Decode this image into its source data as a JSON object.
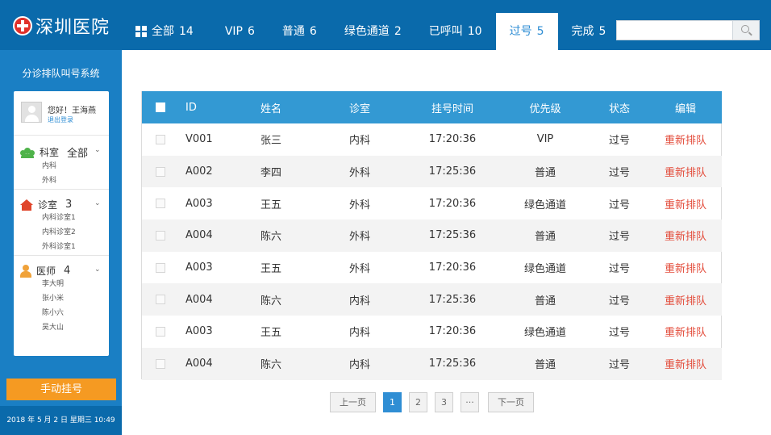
{
  "header": {
    "hospital_name": "深圳医院",
    "tabs": [
      {
        "label": "全部",
        "count": "14"
      },
      {
        "label": "VIP",
        "count": "6"
      },
      {
        "label": "普通",
        "count": "6"
      },
      {
        "label": "绿色通道",
        "count": "2"
      },
      {
        "label": "已呼叫",
        "count": "10"
      },
      {
        "label": "过号",
        "count": "5"
      },
      {
        "label": "完成",
        "count": "5"
      }
    ],
    "active_tab": "过号",
    "search_placeholder": "",
    "search_value": ""
  },
  "sidebar": {
    "system_title": "分诊排队叫号系统",
    "greeting": "您好！王海燕",
    "logout": "退出登录",
    "departments": {
      "label": "科室",
      "value": "全部",
      "items": [
        "内科",
        "外科"
      ]
    },
    "clinics": {
      "label": "诊室",
      "value": "3",
      "items": [
        "内科诊室1",
        "内科诊室2",
        "外科诊室1"
      ]
    },
    "doctors": {
      "label": "医师",
      "value": "4",
      "items": [
        "李大明",
        "张小米",
        "陈小六",
        "吴大山"
      ]
    },
    "manual_register": "手动挂号",
    "datetime": "2018 年 5 月 2 日 星期三  10:49"
  },
  "table": {
    "columns": [
      "ID",
      "姓名",
      "诊室",
      "挂号时间",
      "优先级",
      "状态",
      "编辑"
    ],
    "rows": [
      {
        "id": "V001",
        "name": "张三",
        "room": "内科",
        "time": "17:20:36",
        "priority": "VIP",
        "status": "过号",
        "action": "重新排队"
      },
      {
        "id": "A002",
        "name": "李四",
        "room": "外科",
        "time": "17:25:36",
        "priority": "普通",
        "status": "过号",
        "action": "重新排队"
      },
      {
        "id": "A003",
        "name": "王五",
        "room": "外科",
        "time": "17:20:36",
        "priority": "绿色通道",
        "status": "过号",
        "action": "重新排队"
      },
      {
        "id": "A004",
        "name": "陈六",
        "room": "外科",
        "time": "17:25:36",
        "priority": "普通",
        "status": "过号",
        "action": "重新排队"
      },
      {
        "id": "A003",
        "name": "王五",
        "room": "外科",
        "time": "17:20:36",
        "priority": "绿色通道",
        "status": "过号",
        "action": "重新排队"
      },
      {
        "id": "A004",
        "name": "陈六",
        "room": "内科",
        "time": "17:25:36",
        "priority": "普通",
        "status": "过号",
        "action": "重新排队"
      },
      {
        "id": "A003",
        "name": "王五",
        "room": "内科",
        "time": "17:20:36",
        "priority": "绿色通道",
        "status": "过号",
        "action": "重新排队"
      },
      {
        "id": "A004",
        "name": "陈六",
        "room": "内科",
        "time": "17:25:36",
        "priority": "普通",
        "status": "过号",
        "action": "重新排队"
      }
    ]
  },
  "pagination": {
    "prev": "上一页",
    "pages": [
      "1",
      "2",
      "3",
      "···"
    ],
    "current": "1",
    "next": "下一页"
  },
  "colors": {
    "header_bg": "#0a6aab",
    "sidebar_bg": "#1a7fc4",
    "table_header_bg": "#3399d3",
    "accent": "#2f8ed4",
    "manual_button": "#f59a22",
    "requeue_link": "#e34b3a"
  }
}
